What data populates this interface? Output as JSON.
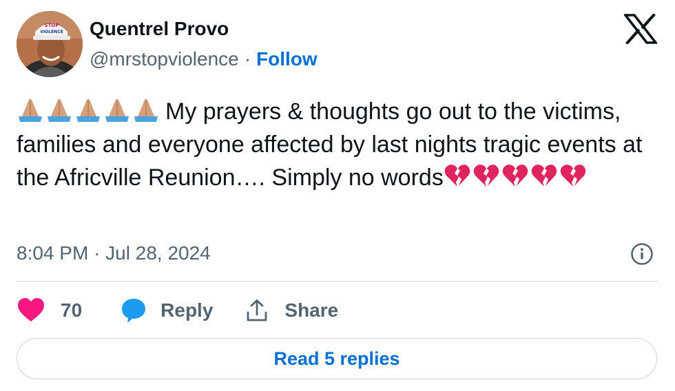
{
  "author": {
    "name": "Quentrel Provo",
    "handle": "@mrstopviolence",
    "separator": "·",
    "follow_label": "Follow",
    "avatar_hat_text": "STOP VIOLENCE"
  },
  "logo_icon": "x-logo-icon",
  "tweet": {
    "leading_emoji": "🙏🏽🙏🏽🙏🏽🙏🏽🙏🏽",
    "text": "My prayers & thoughts go out to the victims, families and everyone affected by last nights tragic events at the Africville Reunion…. Simply no words",
    "trailing_emoji": "💔💔💔💔💔"
  },
  "timestamp": {
    "time": "8:04 PM",
    "separator": "·",
    "date": "Jul 28, 2024"
  },
  "actions": {
    "like_count": "70",
    "reply_label": "Reply",
    "share_label": "Share"
  },
  "read_replies_label": "Read 5 replies",
  "colors": {
    "accent": "#006fd6",
    "like": "#f91880",
    "reply_bubble": "#1d9bf0",
    "secondary_text": "#536471",
    "border": "#cfd9de"
  }
}
